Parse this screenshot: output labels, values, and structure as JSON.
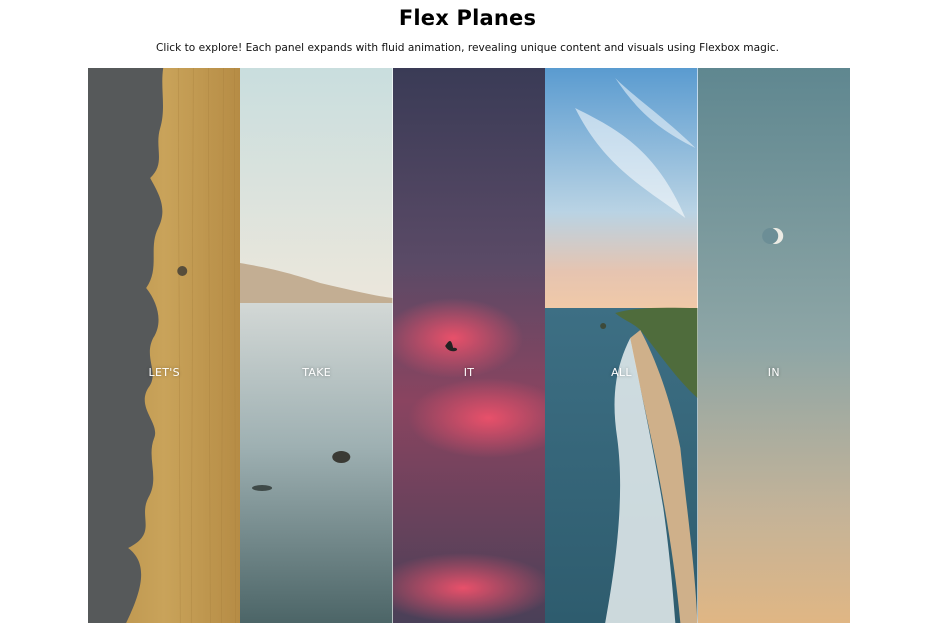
{
  "header": {
    "title": "Flex Planes",
    "subtitle": "Click to explore! Each panel expands with fluid animation, revealing unique content and visuals using Flexbox magic."
  },
  "panels": [
    {
      "label": "LET'S",
      "image": "sandy-shore-shadow"
    },
    {
      "label": "TAKE",
      "image": "swimmer-in-sea"
    },
    {
      "label": "IT",
      "image": "bird-pink-clouds"
    },
    {
      "label": "ALL",
      "image": "aerial-coastline"
    },
    {
      "label": "IN",
      "image": "moon-gradient-sky"
    }
  ],
  "colors": {
    "text": "#000000",
    "panel_label": "#ffffff"
  }
}
